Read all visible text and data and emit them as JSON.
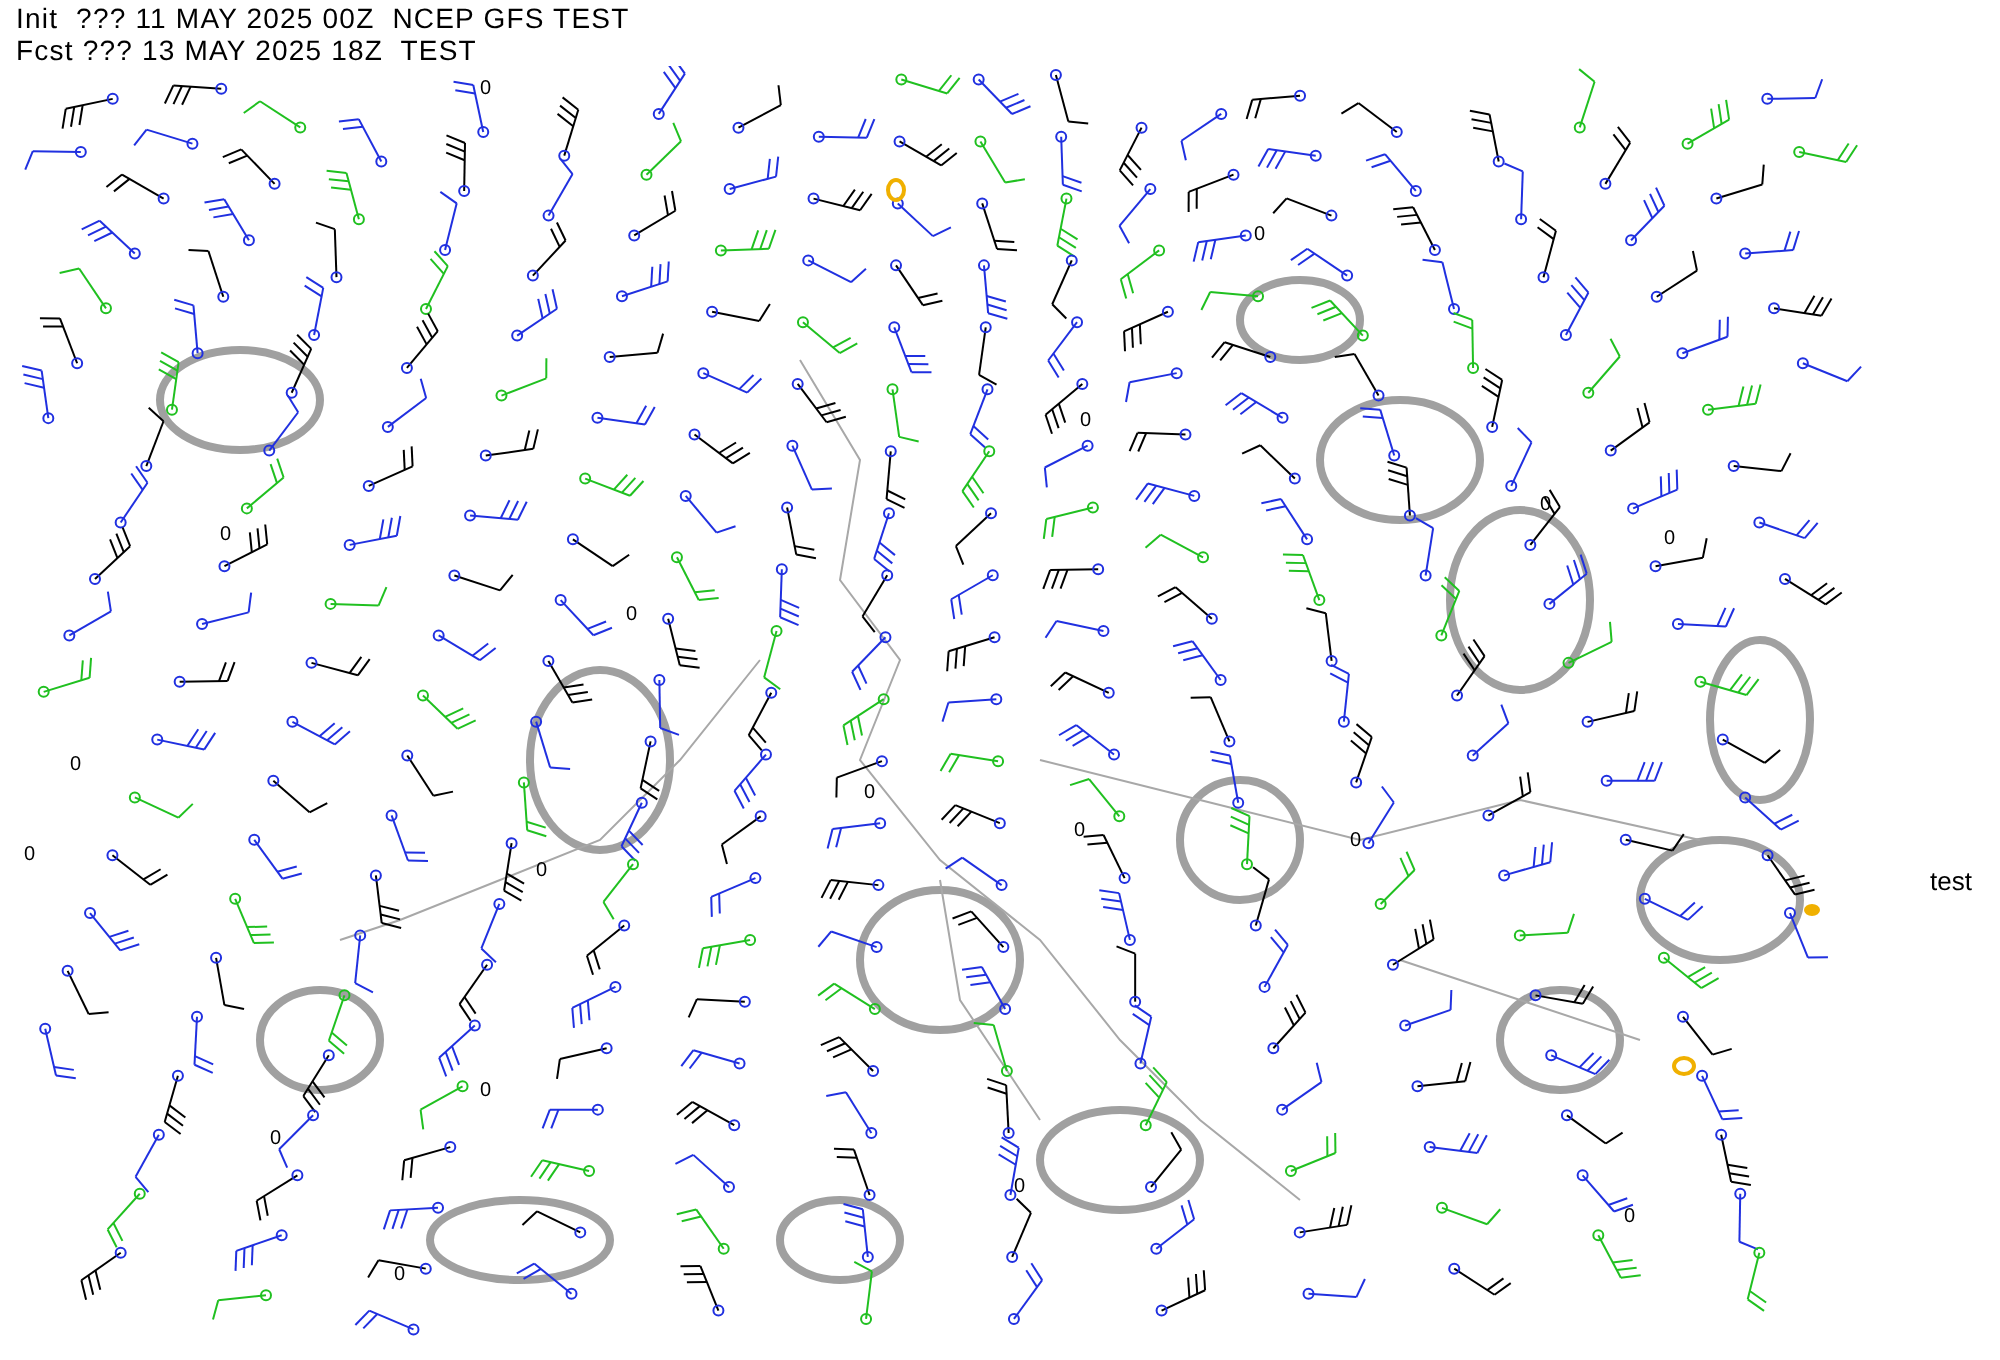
{
  "header": {
    "lines": [
      "Init  ??? 11 MAY 2025 00Z  NCEP GFS TEST",
      "Fcst ??? 13 MAY 2025 18Z  TEST"
    ]
  },
  "side_label": "test",
  "map": {
    "contour_labels": [
      "0",
      "0",
      "0",
      "0",
      "0",
      "0",
      "0",
      "0",
      "0",
      "0",
      "0",
      "0",
      "0",
      "0",
      "0",
      "0",
      "0",
      "0"
    ]
  }
}
